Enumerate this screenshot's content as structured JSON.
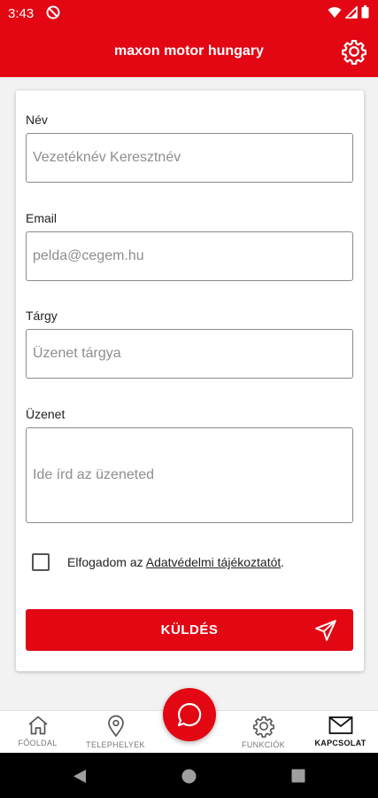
{
  "status_bar": {
    "time": "3:43"
  },
  "app_bar": {
    "title": "maxon motor hungary"
  },
  "form": {
    "name_label": "Név",
    "name_placeholder": "Vezetéknév Keresztnév",
    "email_label": "Email",
    "email_placeholder": "pelda@cegem.hu",
    "subject_label": "Tárgy",
    "subject_placeholder": "Üzenet tárgya",
    "message_label": "Üzenet",
    "message_placeholder": "Ide írd az üzeneted",
    "consent_prefix": "Elfogadom az ",
    "consent_link": "Adatvédelmi tájékoztatót",
    "consent_suffix": ".",
    "consent_checked": false,
    "send_label": "KÜLDÉS"
  },
  "bottom_nav": {
    "items": [
      {
        "label": "FŐOLDAL",
        "icon": "home-icon",
        "active": false
      },
      {
        "label": "TELEPHELYEK",
        "icon": "location-pin-icon",
        "active": false
      },
      {
        "label": "FUNKCIÓK",
        "icon": "gear-icon",
        "active": false
      },
      {
        "label": "KAPCSOLAT",
        "icon": "mail-icon",
        "active": true
      }
    ],
    "fab_icon": "chat-bubble-icon"
  },
  "colors": {
    "accent": "#e30613",
    "text": "#222222",
    "placeholder": "#8e8e8e"
  }
}
